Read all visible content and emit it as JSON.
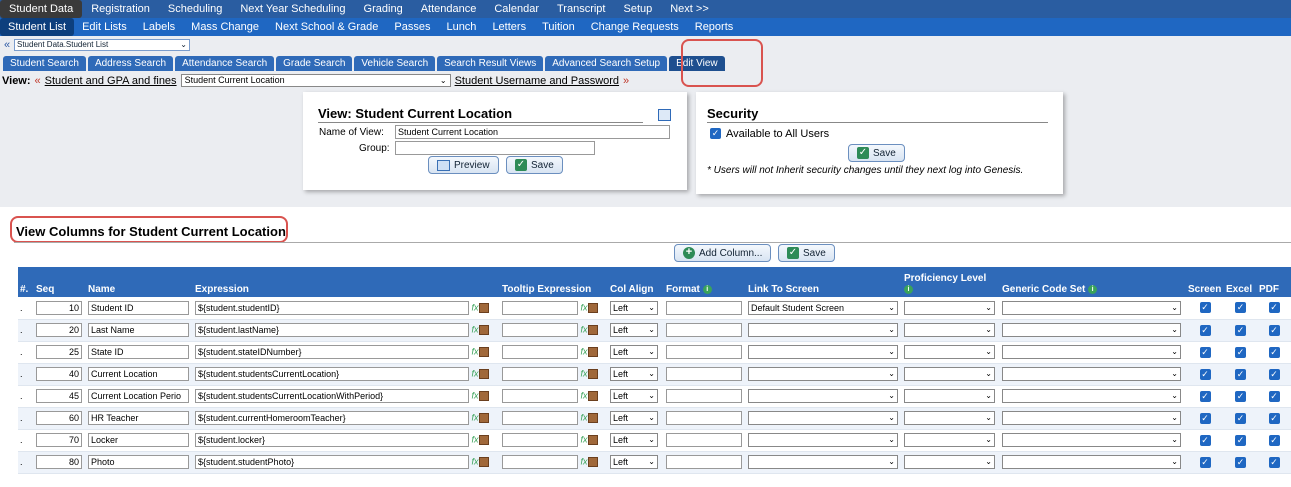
{
  "nav": {
    "primary": [
      "Student Data",
      "Registration",
      "Scheduling",
      "Next Year Scheduling",
      "Grading",
      "Attendance",
      "Calendar",
      "Transcript",
      "Setup",
      "Next >>"
    ],
    "secondary": [
      "Student List",
      "Edit Lists",
      "Labels",
      "Mass Change",
      "Next School & Grade",
      "Passes",
      "Lunch",
      "Letters",
      "Tuition",
      "Change Requests",
      "Reports"
    ]
  },
  "breadcrumb": {
    "back": "«",
    "selected": "Student Data.Student List"
  },
  "tabs": [
    "Student Search",
    "Address Search",
    "Attendance Search",
    "Grade Search",
    "Vehicle Search",
    "Search Result Views",
    "Advanced Search Setup",
    "Edit View"
  ],
  "view_row": {
    "label": "View:",
    "prev_arrow": "«",
    "prev_link": "Student and GPA and fines",
    "selected": "Student Current Location",
    "next_link": "Student Username and Password",
    "next_arrow": "»"
  },
  "view_panel": {
    "title": "View: Student Current Location",
    "name_label": "Name of View:",
    "name_value": "Student Current Location",
    "group_label": "Group:",
    "group_value": "",
    "preview_label": "Preview",
    "save_label": "Save"
  },
  "security_panel": {
    "title": "Security",
    "available_label": "Available to All Users",
    "available_checked": true,
    "save_label": "Save",
    "note": "* Users will not Inherit security changes until they next log into Genesis."
  },
  "columns_section": {
    "title": "View Columns for Student Current Location",
    "add_column_label": "Add Column...",
    "save_label": "Save"
  },
  "table": {
    "headers": {
      "hash": "#.",
      "seq": "Seq",
      "name": "Name",
      "expression": "Expression",
      "tooltip": "Tooltip Expression",
      "col_align": "Col Align",
      "format": "Format",
      "link": "Link To Screen",
      "proficiency": "Proficiency Level",
      "generic_code": "Generic Code Set",
      "screen": "Screen",
      "excel": "Excel",
      "pdf": "PDF"
    },
    "rows": [
      {
        "dot": ".",
        "seq": "10",
        "name": "Student ID",
        "expression": "${student.studentID}",
        "align": "Left",
        "link": "Default Student Screen"
      },
      {
        "dot": ".",
        "seq": "20",
        "name": "Last Name",
        "expression": "${student.lastName}",
        "align": "Left",
        "link": ""
      },
      {
        "dot": ".",
        "seq": "25",
        "name": "State ID",
        "expression": "${student.stateIDNumber}",
        "align": "Left",
        "link": ""
      },
      {
        "dot": ".",
        "seq": "40",
        "name": "Current Location",
        "expression": "${student.studentsCurrentLocation}",
        "align": "Left",
        "link": ""
      },
      {
        "dot": ".",
        "seq": "45",
        "name": "Current Location Perio",
        "expression": "${student.studentsCurrentLocationWithPeriod}",
        "align": "Left",
        "link": ""
      },
      {
        "dot": ".",
        "seq": "60",
        "name": "HR Teacher",
        "expression": "${student.currentHomeroomTeacher}",
        "align": "Left",
        "link": ""
      },
      {
        "dot": ".",
        "seq": "70",
        "name": "Locker",
        "expression": "${student.locker}",
        "align": "Left",
        "link": ""
      },
      {
        "dot": ".",
        "seq": "80",
        "name": "Photo",
        "expression": "${student.studentPhoto}",
        "align": "Left",
        "link": ""
      }
    ]
  },
  "icons": {
    "check": "check-icon",
    "add": "plus-circle-icon",
    "info": "info-icon",
    "fx": "fx-icon",
    "box": "box-icon",
    "calendar": "calendar-icon",
    "preview": "preview-icon"
  },
  "colors": {
    "nav_primary": "#2a5da1",
    "nav_secondary": "#1f67c2",
    "header": "#2f6ab8",
    "highlight": "#d9534f"
  }
}
